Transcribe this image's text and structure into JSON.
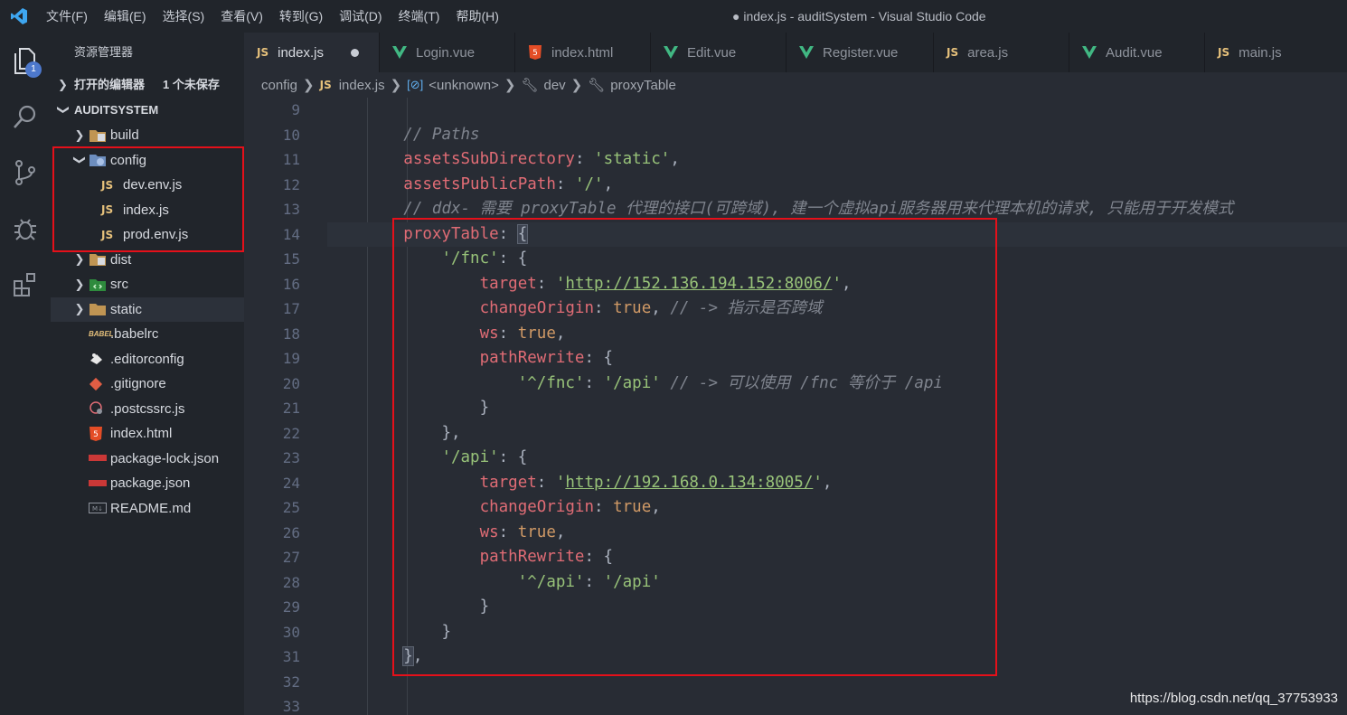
{
  "titlebar": {
    "menus": [
      "文件(F)",
      "编辑(E)",
      "选择(S)",
      "查看(V)",
      "转到(G)",
      "调试(D)",
      "终端(T)",
      "帮助(H)"
    ],
    "window_title": "● index.js - auditSystem - Visual Studio Code"
  },
  "activity": {
    "badge": "1"
  },
  "sidebar": {
    "title": "资源管理器",
    "open_editors": "打开的编辑器",
    "unsaved": "1 个未保存",
    "project": "AUDITSYSTEM",
    "tree": [
      {
        "label": "build",
        "type": "folder"
      },
      {
        "label": "config",
        "type": "folder-open"
      },
      {
        "label": "dev.env.js",
        "type": "js"
      },
      {
        "label": "index.js",
        "type": "js"
      },
      {
        "label": "prod.env.js",
        "type": "js"
      },
      {
        "label": "dist",
        "type": "folder"
      },
      {
        "label": "src",
        "type": "folder"
      },
      {
        "label": "static",
        "type": "folder"
      },
      {
        "label": ".babelrc",
        "type": "babel"
      },
      {
        "label": ".editorconfig",
        "type": "editorconfig"
      },
      {
        "label": ".gitignore",
        "type": "git"
      },
      {
        "label": ".postcssrc.js",
        "type": "postcss"
      },
      {
        "label": "index.html",
        "type": "html"
      },
      {
        "label": "package-lock.json",
        "type": "npm"
      },
      {
        "label": "package.json",
        "type": "npm"
      },
      {
        "label": "README.md",
        "type": "md"
      }
    ]
  },
  "tabs": [
    {
      "label": "index.js",
      "type": "js",
      "active": true
    },
    {
      "label": "Login.vue",
      "type": "vue"
    },
    {
      "label": "index.html",
      "type": "html"
    },
    {
      "label": "Edit.vue",
      "type": "vue"
    },
    {
      "label": "Register.vue",
      "type": "vue"
    },
    {
      "label": "area.js",
      "type": "js"
    },
    {
      "label": "Audit.vue",
      "type": "vue"
    },
    {
      "label": "main.js",
      "type": "js"
    }
  ],
  "breadcrumb": [
    "config",
    "index.js",
    "<unknown>",
    "dev",
    "proxyTable"
  ],
  "editor": {
    "line_numbers": [
      "9",
      "10",
      "11",
      "12",
      "13",
      "14",
      "15",
      "16",
      "17",
      "18",
      "19",
      "20",
      "21",
      "22",
      "23",
      "24",
      "25",
      "26",
      "27",
      "28",
      "29",
      "30",
      "31",
      "32",
      "33"
    ],
    "comment_paths": "// Paths",
    "assets_sub_key": "assetsSubDirectory",
    "assets_sub_val": "'static'",
    "assets_pub_key": "assetsPublicPath",
    "assets_pub_val": "'/'",
    "comment_proxy": "// ddx- 需要 proxyTable 代理的接口(可跨域), 建一个虚拟api服务器用来代理本机的请求, 只能用于开发模式",
    "proxy_key": "proxyTable",
    "fnc_key": "'/fnc'",
    "target_key": "target",
    "fnc_target": "http://152.136.194.152:8006/",
    "change_origin_key": "changeOrigin",
    "true_val": "true",
    "comment_cross": "// -> 指示是否跨域",
    "ws_key": "ws",
    "path_rewrite_key": "pathRewrite",
    "fnc_rewrite_from": "'^/fnc'",
    "api_path": "'/api'",
    "comment_equiv": "// -> 可以使用 /fnc 等价于 /api",
    "api_key": "'/api'",
    "api_target": "http://192.168.0.134:8005/",
    "api_rewrite_from": "'^/api'"
  },
  "watermark": "https://blog.csdn.net/qq_37753933"
}
